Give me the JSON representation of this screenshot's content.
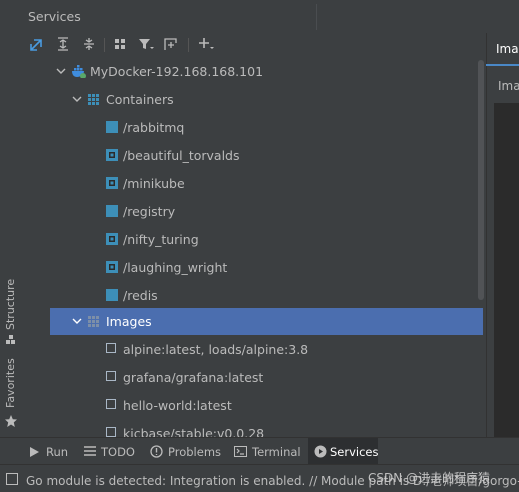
{
  "window": {
    "title": "Services"
  },
  "colors": {
    "accent": "#4b6eaf",
    "container_icon": "#3d8fb8",
    "docker_blue": "#3f8dde",
    "background": "#3c3f41"
  },
  "toolbar": {
    "icons": [
      "expand-icon",
      "collapse-all-icon",
      "expand-all-icon",
      "group-icon",
      "filter-icon",
      "new-tab-icon",
      "add-icon"
    ]
  },
  "tree": {
    "root": {
      "label": "MyDocker-192.168.168.101"
    },
    "containers_group": {
      "label": "Containers"
    },
    "containers": [
      {
        "label": "/rabbitmq",
        "running": false
      },
      {
        "label": "/beautiful_torvalds",
        "running": true
      },
      {
        "label": "/minikube",
        "running": true
      },
      {
        "label": "/registry",
        "running": false
      },
      {
        "label": "/nifty_turing",
        "running": true
      },
      {
        "label": "/laughing_wright",
        "running": true
      },
      {
        "label": "/redis",
        "running": false
      }
    ],
    "images_group": {
      "label": "Images",
      "selected": true
    },
    "images": [
      {
        "label": "alpine:latest, loads/alpine:3.8"
      },
      {
        "label": "grafana/grafana:latest"
      },
      {
        "label": "hello-world:latest"
      },
      {
        "label": "kicbase/stable:v0.0.28"
      }
    ]
  },
  "side_labels": {
    "structure": "Structure",
    "favorites": "Favorites"
  },
  "right_panel": {
    "tab": "Imag",
    "label": "Ima"
  },
  "bottom_tabs": [
    {
      "label": "Run",
      "icon": "play-icon",
      "active": false
    },
    {
      "label": "TODO",
      "icon": "list-icon",
      "active": false
    },
    {
      "label": "Problems",
      "icon": "warning-icon",
      "active": false
    },
    {
      "label": "Terminal",
      "icon": "terminal-icon",
      "active": false
    },
    {
      "label": "Services",
      "icon": "services-icon",
      "active": true
    }
  ],
  "status": {
    "message": "Go module is detected: Integration is enabled. // Module path is  D:/老师项目/gorgo-c",
    "watermark": "CSDN @进击的程序猿"
  }
}
